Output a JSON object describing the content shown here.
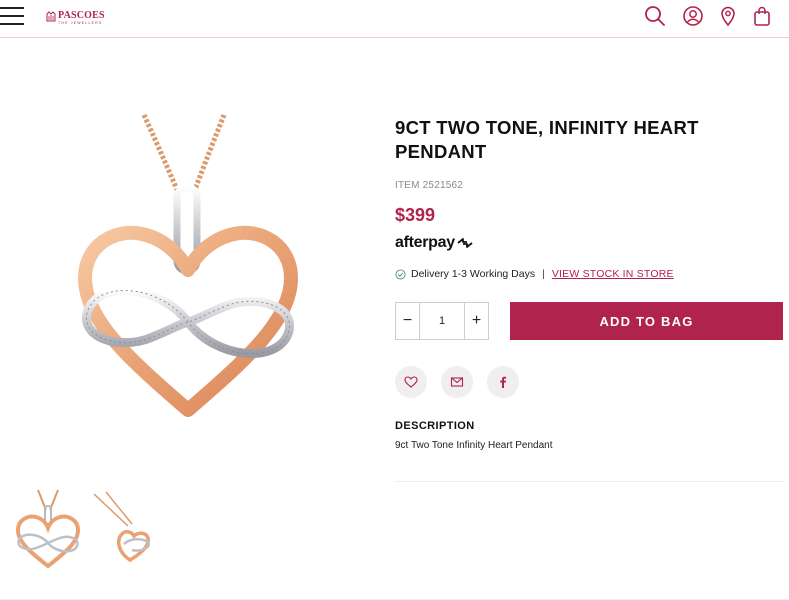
{
  "header": {
    "brand": "PASCOES",
    "brand_tagline": "THE JEWELLERS",
    "icons": [
      "menu-icon",
      "search-icon",
      "account-icon",
      "store-locator-icon",
      "bag-icon"
    ],
    "accent_color": "#b0234a"
  },
  "product": {
    "title": "9CT TWO TONE, INFINITY HEART PENDANT",
    "item_number": "ITEM 2521562",
    "price": "$399",
    "afterpay_label": "afterpay",
    "delivery_text": "Delivery 1-3 Working Days",
    "delivery_separator": "|",
    "stock_link": "VIEW STOCK IN STORE",
    "quantity": "1",
    "qty_minus": "−",
    "qty_plus": "+",
    "add_to_bag": "ADD TO BAG",
    "share_icons": [
      "heart-icon",
      "email-icon",
      "facebook-icon"
    ],
    "description_heading": "DESCRIPTION",
    "description_text": "9ct Two Tone Infinity Heart Pendant"
  },
  "gallery": {
    "thumbnail_count": 2
  }
}
